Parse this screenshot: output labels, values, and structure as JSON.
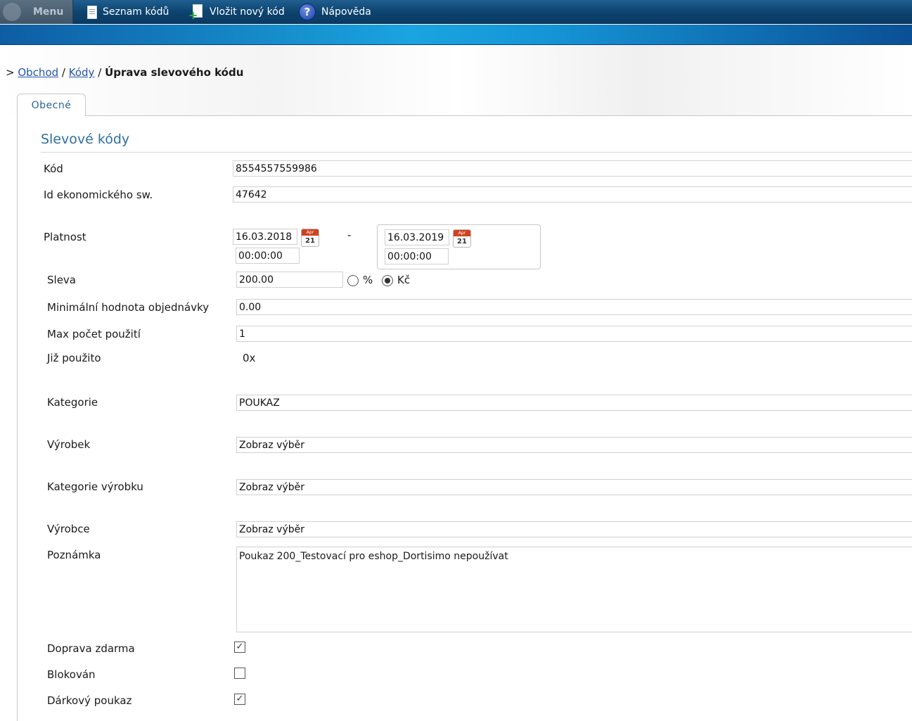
{
  "menu": {
    "menu_label": "Menu",
    "items": [
      {
        "label": "Seznam kódů"
      },
      {
        "label": "Vložit nový kód"
      },
      {
        "label": "Nápověda"
      }
    ]
  },
  "breadcrumb": {
    "prefix": ">",
    "link1": "Obchod",
    "sep": "/",
    "link2": "Kódy",
    "current": "Úprava slevového kódu"
  },
  "tabs": [
    {
      "label": "Obecné"
    }
  ],
  "section": {
    "title": "Slevové kódy"
  },
  "form": {
    "kod": {
      "label": "Kód",
      "value": "8554557559986"
    },
    "id_eko": {
      "label": "Id ekonomického sw.",
      "value": "47642"
    },
    "platnost": {
      "label": "Platnost",
      "from_date": "16.03.2018",
      "from_time": "00:00:00",
      "dash": "-",
      "to_date": "16.03.2019",
      "to_time": "00:00:00",
      "calendar": {
        "month": "Apr",
        "day": "21"
      }
    },
    "sleva": {
      "label": "Sleva",
      "value": "200.00",
      "opt_percent": "%",
      "opt_kc": "Kč",
      "selected": "Kč"
    },
    "min_hodnota": {
      "label": "Minimální hodnota objednávky",
      "value": "0.00"
    },
    "max_pocet": {
      "label": "Max počet použití",
      "value": "1"
    },
    "jiz_pouzito": {
      "label": "Již použito",
      "value": "0x"
    },
    "kategorie": {
      "label": "Kategorie",
      "value": "POUKAZ"
    },
    "vyrobek": {
      "label": "Výrobek",
      "value": "Zobraz výběr"
    },
    "kategorie_vyrobku": {
      "label": "Kategorie výrobku",
      "value": "Zobraz výběr"
    },
    "vyrobce": {
      "label": "Výrobce",
      "value": "Zobraz výběr"
    },
    "poznamka": {
      "label": "Poznámka",
      "value": "Poukaz 200_Testovací pro eshop_Dortisimo nepoužívat"
    },
    "doprava_zdarma": {
      "label": "Doprava zdarma",
      "checked": true
    },
    "blokovan": {
      "label": "Blokován",
      "checked": false
    },
    "darkovy_poukaz": {
      "label": "Dárkový poukaz",
      "checked": true
    }
  }
}
